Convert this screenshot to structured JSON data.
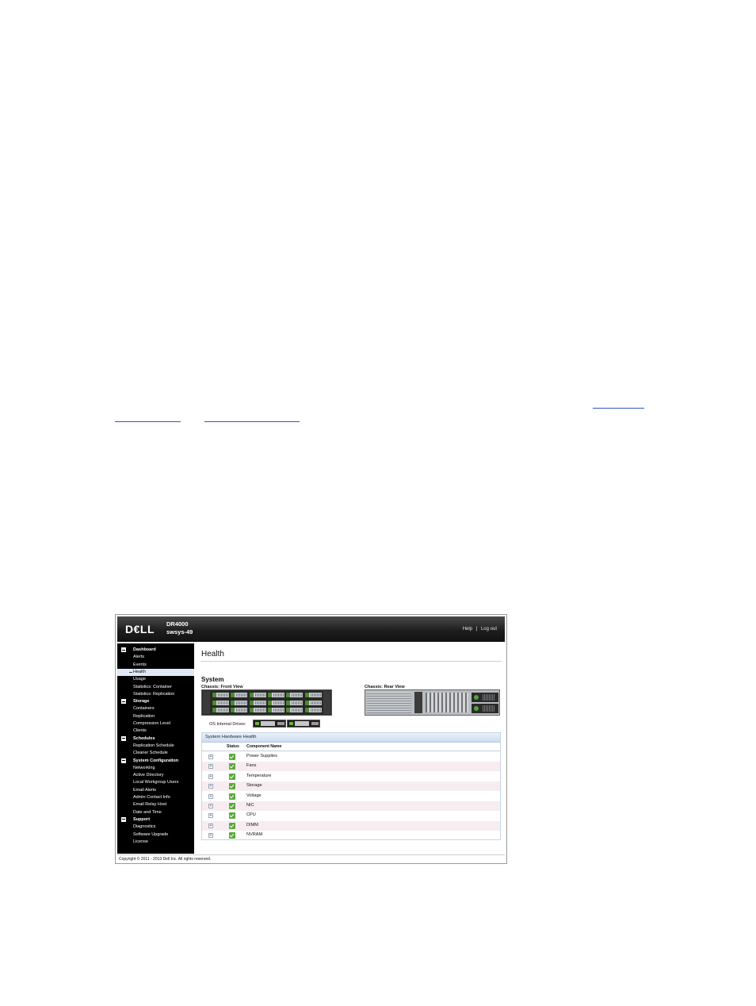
{
  "header": {
    "logo": "D€LL",
    "product": "DR4000",
    "hostname": "swsys-49",
    "help": "Help",
    "separator": "|",
    "logout": "Log out"
  },
  "sidebar": {
    "sections": [
      {
        "label": "Dashboard",
        "items": [
          "Alerts",
          "Events",
          "Health",
          "Usage",
          "Statistics: Container",
          "Statistics: Replication"
        ]
      },
      {
        "label": "Storage",
        "items": [
          "Containers",
          "Replication",
          "Compression Level",
          "Clients"
        ]
      },
      {
        "label": "Schedules",
        "items": [
          "Replication Schedule",
          "Cleaner Schedule"
        ]
      },
      {
        "label": "System Configuration",
        "items": [
          "Networking",
          "Active Directory",
          "Local Workgroup Users",
          "Email Alerts",
          "Admin Contact Info",
          "Email Relay Host",
          "Date and Time"
        ]
      },
      {
        "label": "Support",
        "items": [
          "Diagnostics",
          "Software Upgrade",
          "License"
        ]
      }
    ],
    "active_item": "Health"
  },
  "main": {
    "title": "Health",
    "system_title": "System",
    "front_caption": "Chassis: Front View",
    "rear_caption": "Chassis: Rear View",
    "os_drives_label": "OS Internal Drives:"
  },
  "hardware": {
    "panel_title": "System Hardware Health",
    "col_status": "Status",
    "col_component": "Component Name",
    "rows": [
      "Power Supplies",
      "Fans",
      "Temperature",
      "Storage",
      "Voltage",
      "NIC",
      "CPU",
      "DIMM",
      "NVRAM"
    ]
  },
  "footer": {
    "copyright": "Copyright © 2011 - 2013 Dell Inc. All rights reserved."
  },
  "colors": {
    "header_dark": "#121212",
    "sidebar_bg": "#000000",
    "active_bg": "#dfe8f6",
    "status_ok": "#5aa83a",
    "panel_border": "#c6d4e6"
  }
}
